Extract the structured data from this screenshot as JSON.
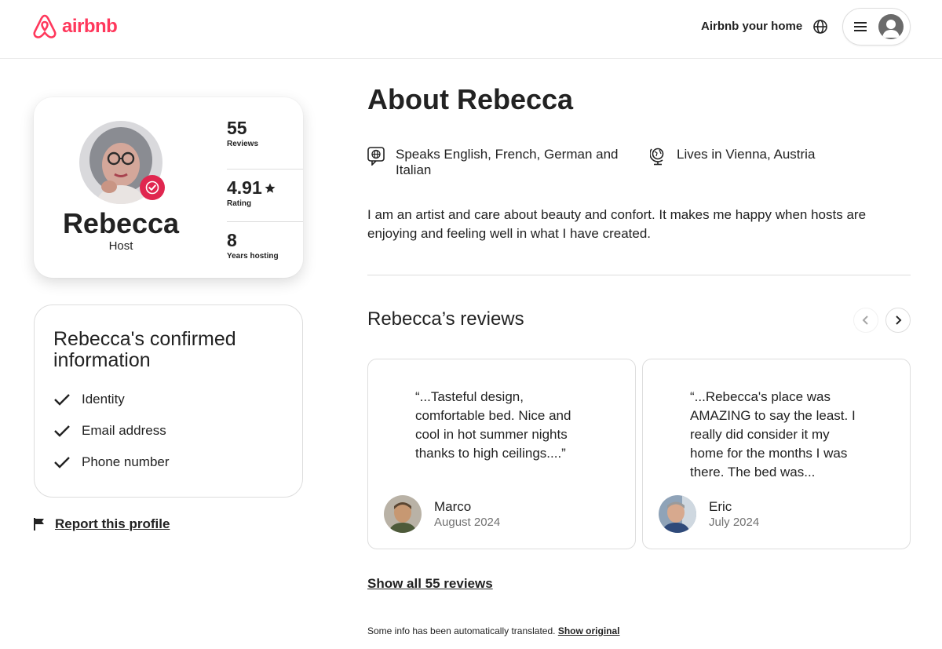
{
  "header": {
    "brand": "airbnb",
    "airbnb_your_home": "Airbnb your home",
    "brand_color": "#FF385C"
  },
  "profile": {
    "name": "Rebecca",
    "role": "Host",
    "stats": [
      {
        "value": "55",
        "label": "Reviews"
      },
      {
        "value": "4.91",
        "label": "Rating"
      },
      {
        "value": "8",
        "label": "Years hosting"
      }
    ]
  },
  "confirmed": {
    "title": "Rebecca's confirmed information",
    "items": [
      "Identity",
      "Email address",
      "Phone number"
    ]
  },
  "report": "Report this profile",
  "about": {
    "title": "About Rebecca",
    "languages": "Speaks English, French, German and Italian",
    "location": "Lives in Vienna, Austria",
    "bio": "I am an artist and care about beauty and confort. It makes me happy when hosts are enjoying and feeling well in what I have created."
  },
  "reviews": {
    "title": "Rebecca’s reviews",
    "items": [
      {
        "text": "“...Tasteful design, comfortable bed. Nice and cool in hot summer nights thanks to high ceilings....”",
        "name": "Marco",
        "date": "August 2024"
      },
      {
        "text": "“...Rebecca's place was AMAZING to say the least. I really did consider it my home for the months I was there. The bed was...",
        "name": "Eric",
        "date": "July 2024"
      }
    ],
    "show_all": "Show all 55 reviews"
  },
  "footer_note": {
    "text": "Some info has been automatically translated.",
    "link": "Show original"
  }
}
